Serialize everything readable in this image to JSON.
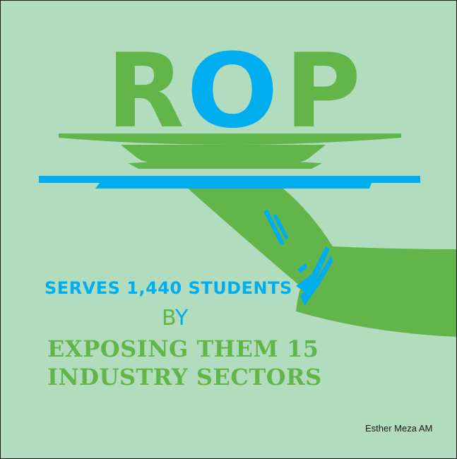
{
  "headline": {
    "r": "R",
    "o": "O",
    "p": "P"
  },
  "lines": {
    "serves": "SERVES 1,440 STUDENTS",
    "by_b": "B",
    "by_y": "Y",
    "exposing": "EXPOSING THEM 15",
    "industry": "INDUSTRY SECTORS"
  },
  "credit": "Esther Meza AM",
  "colors": {
    "background": "#b2dcbe",
    "green": "#62b649",
    "blue": "#00aeef"
  }
}
